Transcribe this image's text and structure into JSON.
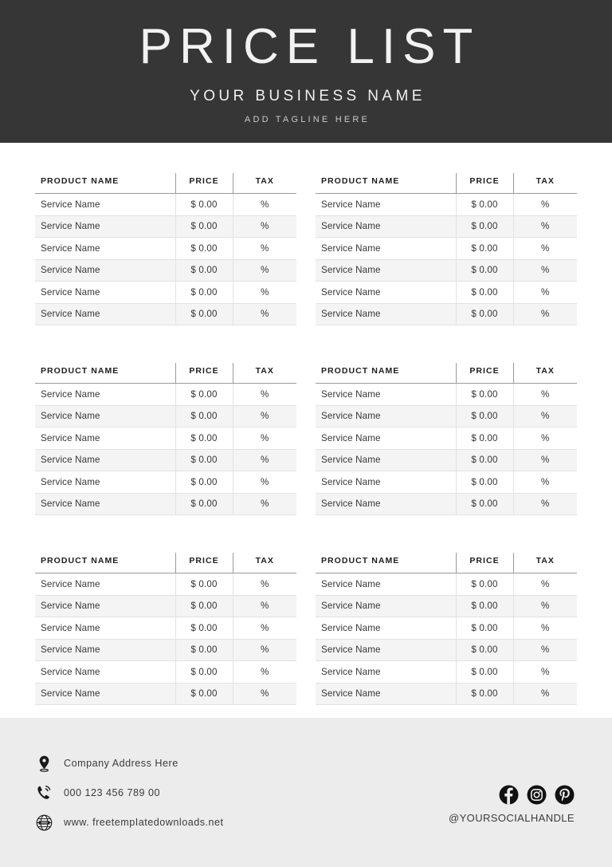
{
  "header": {
    "title": "PRICE LIST",
    "business_name": "YOUR BUSINESS NAME",
    "tagline": "ADD TAGLINE HERE",
    "background_color": "#363636",
    "text_color": "#f2f2f2"
  },
  "columns": {
    "name": "PRODUCT NAME",
    "price": "PRICE",
    "tax": "TAX"
  },
  "row": {
    "name": "Service Name",
    "price": "$ 0.00",
    "tax": "%"
  },
  "tables": [
    {
      "id": "table-1",
      "headers": [
        "PRODUCT NAME",
        "PRICE",
        "TAX"
      ],
      "rows": [
        {
          "name": "Service Name",
          "price": "$ 0.00",
          "tax": "%"
        },
        {
          "name": "Service Name",
          "price": "$ 0.00",
          "tax": "%"
        },
        {
          "name": "Service Name",
          "price": "$ 0.00",
          "tax": "%"
        },
        {
          "name": "Service Name",
          "price": "$ 0.00",
          "tax": "%"
        },
        {
          "name": "Service Name",
          "price": "$ 0.00",
          "tax": "%"
        },
        {
          "name": "Service Name",
          "price": "$ 0.00",
          "tax": "%"
        }
      ]
    },
    {
      "id": "table-2",
      "headers": [
        "PRODUCT NAME",
        "PRICE",
        "TAX"
      ],
      "rows": [
        {
          "name": "Service Name",
          "price": "$ 0.00",
          "tax": "%"
        },
        {
          "name": "Service Name",
          "price": "$ 0.00",
          "tax": "%"
        },
        {
          "name": "Service Name",
          "price": "$ 0.00",
          "tax": "%"
        },
        {
          "name": "Service Name",
          "price": "$ 0.00",
          "tax": "%"
        },
        {
          "name": "Service Name",
          "price": "$ 0.00",
          "tax": "%"
        },
        {
          "name": "Service Name",
          "price": "$ 0.00",
          "tax": "%"
        }
      ]
    },
    {
      "id": "table-3",
      "headers": [
        "PRODUCT NAME",
        "PRICE",
        "TAX"
      ],
      "rows": [
        {
          "name": "Service Name",
          "price": "$ 0.00",
          "tax": "%"
        },
        {
          "name": "Service Name",
          "price": "$ 0.00",
          "tax": "%"
        },
        {
          "name": "Service Name",
          "price": "$ 0.00",
          "tax": "%"
        },
        {
          "name": "Service Name",
          "price": "$ 0.00",
          "tax": "%"
        },
        {
          "name": "Service Name",
          "price": "$ 0.00",
          "tax": "%"
        },
        {
          "name": "Service Name",
          "price": "$ 0.00",
          "tax": "%"
        }
      ]
    },
    {
      "id": "table-4",
      "headers": [
        "PRODUCT NAME",
        "PRICE",
        "TAX"
      ],
      "rows": [
        {
          "name": "Service Name",
          "price": "$ 0.00",
          "tax": "%"
        },
        {
          "name": "Service Name",
          "price": "$ 0.00",
          "tax": "%"
        },
        {
          "name": "Service Name",
          "price": "$ 0.00",
          "tax": "%"
        },
        {
          "name": "Service Name",
          "price": "$ 0.00",
          "tax": "%"
        },
        {
          "name": "Service Name",
          "price": "$ 0.00",
          "tax": "%"
        },
        {
          "name": "Service Name",
          "price": "$ 0.00",
          "tax": "%"
        }
      ]
    },
    {
      "id": "table-5",
      "headers": [
        "PRODUCT NAME",
        "PRICE",
        "TAX"
      ],
      "rows": [
        {
          "name": "Service Name",
          "price": "$ 0.00",
          "tax": "%"
        },
        {
          "name": "Service Name",
          "price": "$ 0.00",
          "tax": "%"
        },
        {
          "name": "Service Name",
          "price": "$ 0.00",
          "tax": "%"
        },
        {
          "name": "Service Name",
          "price": "$ 0.00",
          "tax": "%"
        },
        {
          "name": "Service Name",
          "price": "$ 0.00",
          "tax": "%"
        },
        {
          "name": "Service Name",
          "price": "$ 0.00",
          "tax": "%"
        }
      ]
    },
    {
      "id": "table-6",
      "headers": [
        "PRODUCT NAME",
        "PRICE",
        "TAX"
      ],
      "rows": [
        {
          "name": "Service Name",
          "price": "$ 0.00",
          "tax": "%"
        },
        {
          "name": "Service Name",
          "price": "$ 0.00",
          "tax": "%"
        },
        {
          "name": "Service Name",
          "price": "$ 0.00",
          "tax": "%"
        },
        {
          "name": "Service Name",
          "price": "$ 0.00",
          "tax": "%"
        },
        {
          "name": "Service Name",
          "price": "$ 0.00",
          "tax": "%"
        },
        {
          "name": "Service Name",
          "price": "$ 0.00",
          "tax": "%"
        }
      ]
    }
  ],
  "footer": {
    "background_color": "#ececec",
    "contacts": [
      {
        "icon": "location-pin-icon",
        "text": "Company Address Here"
      },
      {
        "icon": "phone-icon",
        "text": "000 123 456 789 00"
      },
      {
        "icon": "globe-www-icon",
        "text": "www. freetempIatedownloads.net"
      }
    ],
    "social": {
      "icons": [
        "facebook-icon",
        "instagram-icon",
        "pinterest-icon"
      ],
      "handle": "@YOURSOCIALHANDLE"
    }
  }
}
